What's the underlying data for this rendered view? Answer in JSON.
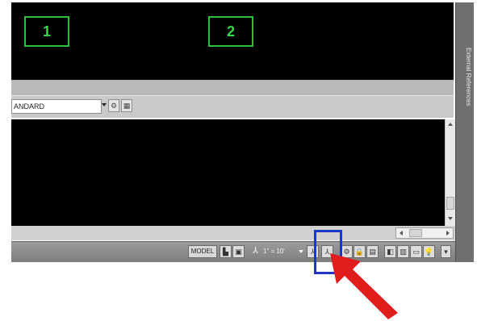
{
  "viewport": {
    "labels": [
      "1",
      "2"
    ]
  },
  "toolbar": {
    "style_value": "ANDARD"
  },
  "statusbar": {
    "model_label": "MODEL",
    "scale_text": "1\" = 10'"
  },
  "side_panel": {
    "title": "External References"
  },
  "colors": {
    "viewport_border": "#2fbf3d",
    "highlight": "#1f35c4",
    "pointer": "#e01d1d"
  }
}
